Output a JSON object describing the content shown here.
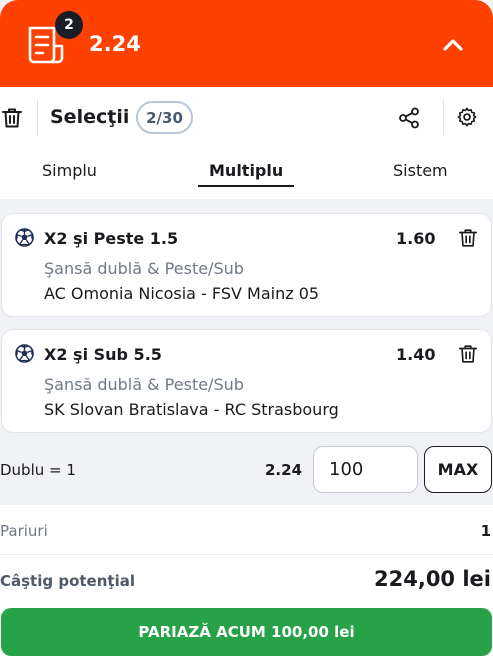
{
  "header": {
    "badge_count": "2",
    "total_odds": "2.24",
    "collapse_icon": "chevron-up-icon",
    "betslip_icon": "betslip-icon",
    "color": "#fd4102"
  },
  "toolbar": {
    "title": "Selecţii",
    "count": "2/30",
    "icons": [
      "trash-icon",
      "share-icon",
      "settings-icon"
    ]
  },
  "tabs": [
    {
      "label": "Simplu",
      "active": false
    },
    {
      "label": "Multiplu",
      "active": true
    },
    {
      "label": "Sistem",
      "active": false
    }
  ],
  "selections": [
    {
      "name": "X2 şi Peste 1.5",
      "odds": "1.60",
      "market": "Şansă dublă & Peste/Sub",
      "match": "AC Omonia Nicosia - FSV Mainz 05",
      "icon": "football-icon"
    },
    {
      "name": "X2 şi Sub 5.5",
      "odds": "1.40",
      "market": "Şansă dublă & Peste/Sub",
      "match": "SK Slovan Bratislava - RC Strasbourg",
      "icon": "football-icon"
    }
  ],
  "stake": {
    "combo_label": "Dublu = 1",
    "combo_odds": "2.24",
    "amount": "100",
    "max_label": "MAX"
  },
  "summary": {
    "bets_label": "Pariuri",
    "bets_value": "1",
    "win_label": "Câştig potenţial",
    "win_value": "224,00 lei"
  },
  "cta": {
    "label": "PARIAZĂ ACUM 100,00 lei",
    "color": "#27a249"
  }
}
